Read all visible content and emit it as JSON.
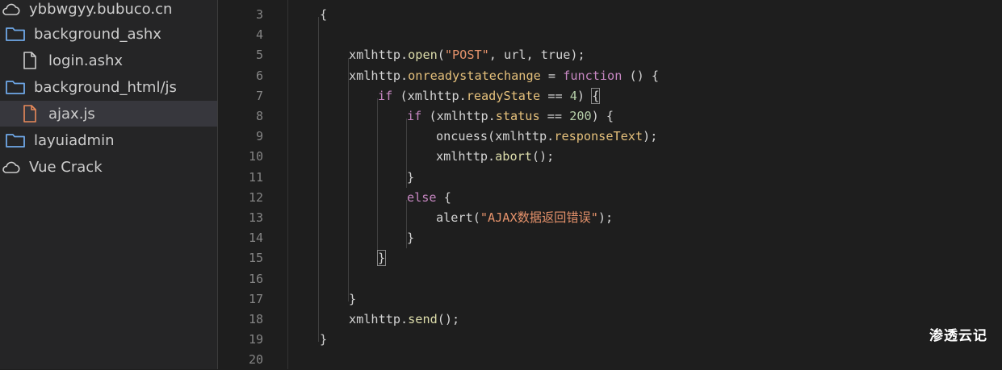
{
  "explorer": {
    "items": [
      {
        "label": "ybbwgyy.bubuco.cn",
        "icon": "cloud-icon"
      },
      {
        "label": "background_ashx",
        "icon": "folder-icon"
      },
      {
        "label": "login.ashx",
        "icon": "file-icon"
      },
      {
        "label": "background_html/js",
        "icon": "folder-icon"
      },
      {
        "label": "ajax.js",
        "icon": "js-file-icon",
        "selected": true
      },
      {
        "label": "layuiadmin",
        "icon": "folder-icon"
      },
      {
        "label": "Vue Crack",
        "icon": "cloud-icon"
      }
    ]
  },
  "editor": {
    "line_numbers": [
      "3",
      "4",
      "5",
      "6",
      "7",
      "8",
      "9",
      "10",
      "11",
      "12",
      "13",
      "14",
      "15",
      "16",
      "17",
      "18",
      "19",
      "20"
    ],
    "lines": [
      [
        {
          "t": "{",
          "k": "plain"
        }
      ],
      [],
      [
        {
          "t": "xmlhttp.",
          "k": "plain"
        },
        {
          "t": "open",
          "k": "func"
        },
        {
          "t": "(",
          "k": "plain"
        },
        {
          "t": "\"POST\"",
          "k": "str"
        },
        {
          "t": ", url, ",
          "k": "plain"
        },
        {
          "t": "true",
          "k": "bool"
        },
        {
          "t": ");",
          "k": "plain"
        }
      ],
      [
        {
          "t": "xmlhttp.",
          "k": "plain"
        },
        {
          "t": "onreadystatechange",
          "k": "prop"
        },
        {
          "t": " = ",
          "k": "plain"
        },
        {
          "t": "function",
          "k": "key"
        },
        {
          "t": " () {",
          "k": "plain"
        }
      ],
      [
        {
          "t": "if",
          "k": "key"
        },
        {
          "t": " (xmlhttp.",
          "k": "plain"
        },
        {
          "t": "readyState",
          "k": "prop"
        },
        {
          "t": " == ",
          "k": "plain"
        },
        {
          "t": "4",
          "k": "num"
        },
        {
          "t": ") ",
          "k": "plain"
        },
        {
          "t": "{",
          "k": "plain",
          "box": true
        }
      ],
      [
        {
          "t": "if",
          "k": "key"
        },
        {
          "t": " (xmlhttp.",
          "k": "plain"
        },
        {
          "t": "status",
          "k": "prop"
        },
        {
          "t": " == ",
          "k": "plain"
        },
        {
          "t": "200",
          "k": "num"
        },
        {
          "t": ") {",
          "k": "plain"
        }
      ],
      [
        {
          "t": "oncuess(xmlhttp.",
          "k": "plain"
        },
        {
          "t": "responseText",
          "k": "prop"
        },
        {
          "t": ");",
          "k": "plain"
        }
      ],
      [
        {
          "t": "xmlhttp.",
          "k": "plain"
        },
        {
          "t": "abort",
          "k": "func"
        },
        {
          "t": "();",
          "k": "plain"
        }
      ],
      [
        {
          "t": "}",
          "k": "plain"
        }
      ],
      [
        {
          "t": "else",
          "k": "key"
        },
        {
          "t": " {",
          "k": "plain"
        }
      ],
      [
        {
          "t": "alert(",
          "k": "plain"
        },
        {
          "t": "\"AJAX数据返回错误\"",
          "k": "str"
        },
        {
          "t": ");",
          "k": "plain"
        }
      ],
      [
        {
          "t": "}",
          "k": "plain"
        }
      ],
      [
        {
          "t": "}",
          "k": "plain",
          "box": true
        }
      ],
      [],
      [
        {
          "t": "}",
          "k": "plain"
        }
      ],
      [
        {
          "t": "xmlhttp.",
          "k": "plain"
        },
        {
          "t": "send",
          "k": "func"
        },
        {
          "t": "();",
          "k": "plain"
        }
      ],
      [
        {
          "t": "}",
          "k": "plain"
        }
      ],
      []
    ]
  },
  "watermark": "渗透云记"
}
